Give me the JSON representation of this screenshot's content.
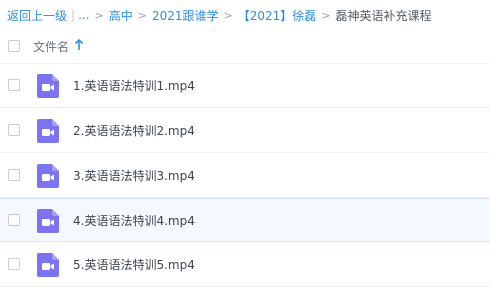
{
  "breadcrumb": {
    "back": "返回上一级",
    "ellipsis": "...",
    "items": [
      "高中",
      "2021跟谁学",
      "【2021】徐磊"
    ],
    "current": "磊神英语补充课程",
    "separator": ">",
    "bar": "|"
  },
  "header": {
    "column_label": "文件名"
  },
  "files": [
    {
      "name": "1.英语语法特训1.mp4",
      "icon": "video-file-icon"
    },
    {
      "name": "2.英语语法特训2.mp4",
      "icon": "video-file-icon"
    },
    {
      "name": "3.英语语法特训3.mp4",
      "icon": "video-file-icon"
    },
    {
      "name": "4.英语语法特训4.mp4",
      "icon": "video-file-icon"
    },
    {
      "name": "5.英语语法特训5.mp4",
      "icon": "video-file-icon"
    }
  ],
  "colors": {
    "link": "#2e8ee6",
    "video_icon": "#7b73f0",
    "row_highlight": "#f4f9ff"
  }
}
